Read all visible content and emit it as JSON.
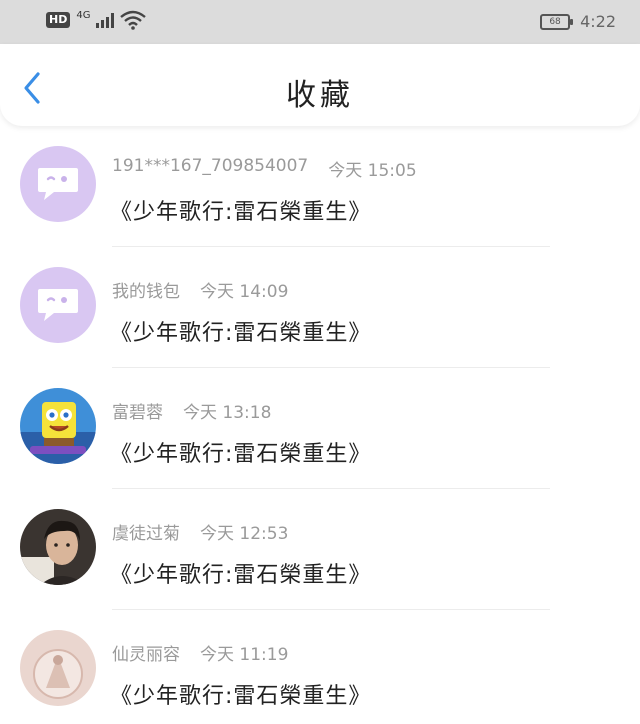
{
  "status_bar": {
    "hd_label": "HD",
    "network_label": "4G",
    "battery_level": "68",
    "time": "4:22"
  },
  "nav": {
    "title": "收藏",
    "back_icon": "chevron-left-icon",
    "accent_color": "#3a8ee6"
  },
  "items": [
    {
      "name": "191***167_709854007",
      "time": "今天 15:05",
      "text": "《少年歌行:雷石榮重生》",
      "avatar": "chat-bubble-avatar"
    },
    {
      "name": "我的钱包",
      "time": "今天 14:09",
      "text": "《少年歌行:雷石榮重生》",
      "avatar": "chat-bubble-avatar"
    },
    {
      "name": "富碧蓉",
      "time": "今天 13:18",
      "text": "《少年歌行:雷石榮重生》",
      "avatar": "cartoon-avatar"
    },
    {
      "name": "虞徒过菊",
      "time": "今天 12:53",
      "text": "《少年歌行:雷石榮重生》",
      "avatar": "person-photo-avatar"
    },
    {
      "name": "仙灵丽容",
      "time": "今天 11:19",
      "text": "《少年歌行:雷石榮重生》",
      "avatar": "photo-avatar"
    }
  ]
}
